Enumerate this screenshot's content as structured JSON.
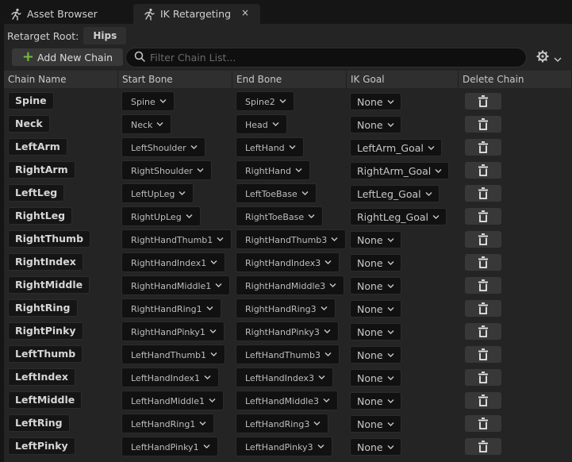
{
  "tabs": [
    {
      "label": "Asset Browser",
      "icon": "running-figure-icon",
      "active": false
    },
    {
      "label": "IK Retargeting",
      "icon": "running-figure-icon",
      "active": true,
      "close_icon": "×"
    }
  ],
  "retarget_root": {
    "label": "Retarget Root:",
    "value": "Hips"
  },
  "toolbar": {
    "add_label": "Add New Chain",
    "search_placeholder": "Filter Chain List...",
    "settings_icon": "gear-icon"
  },
  "columns": [
    "Chain Name",
    "Start Bone",
    "End Bone",
    "IK Goal",
    "Delete Chain"
  ],
  "colors": {
    "accent_plus": "#6fbe3c",
    "panel": "#242424",
    "background": "#151515"
  },
  "chains": [
    {
      "name": "Spine",
      "start": "Spine",
      "end": "Spine2",
      "goal": "None"
    },
    {
      "name": "Neck",
      "start": "Neck",
      "end": "Head",
      "goal": "None"
    },
    {
      "name": "LeftArm",
      "start": "LeftShoulder",
      "end": "LeftHand",
      "goal": "LeftArm_Goal"
    },
    {
      "name": "RightArm",
      "start": "RightShoulder",
      "end": "RightHand",
      "goal": "RightArm_Goal"
    },
    {
      "name": "LeftLeg",
      "start": "LeftUpLeg",
      "end": "LeftToeBase",
      "goal": "LeftLeg_Goal"
    },
    {
      "name": "RightLeg",
      "start": "RightUpLeg",
      "end": "RightToeBase",
      "goal": "RightLeg_Goal"
    },
    {
      "name": "RightThumb",
      "start": "RightHandThumb1",
      "end": "RightHandThumb3",
      "goal": "None"
    },
    {
      "name": "RightIndex",
      "start": "RightHandIndex1",
      "end": "RightHandIndex3",
      "goal": "None"
    },
    {
      "name": "RightMiddle",
      "start": "RightHandMiddle1",
      "end": "RightHandMiddle3",
      "goal": "None"
    },
    {
      "name": "RightRing",
      "start": "RightHandRing1",
      "end": "RightHandRing3",
      "goal": "None"
    },
    {
      "name": "RightPinky",
      "start": "RightHandPinky1",
      "end": "RightHandPinky3",
      "goal": "None"
    },
    {
      "name": "LeftThumb",
      "start": "LeftHandThumb1",
      "end": "LeftHandThumb3",
      "goal": "None"
    },
    {
      "name": "LeftIndex",
      "start": "LeftHandIndex1",
      "end": "LeftHandIndex3",
      "goal": "None"
    },
    {
      "name": "LeftMiddle",
      "start": "LeftHandMiddle1",
      "end": "LeftHandMiddle3",
      "goal": "None"
    },
    {
      "name": "LeftRing",
      "start": "LeftHandRing1",
      "end": "LeftHandRing3",
      "goal": "None"
    },
    {
      "name": "LeftPinky",
      "start": "LeftHandPinky1",
      "end": "LeftHandPinky3",
      "goal": "None"
    }
  ]
}
